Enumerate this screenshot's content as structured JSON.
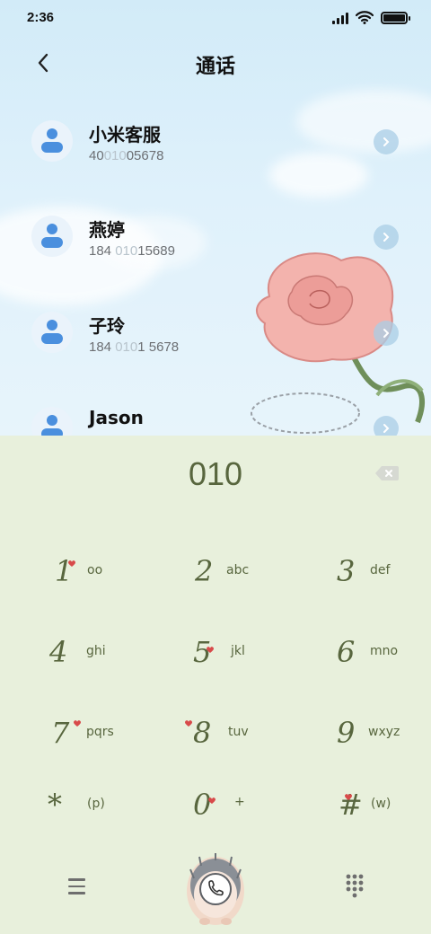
{
  "status_bar": {
    "time": "2:36",
    "icons": [
      "signal-icon",
      "wifi-icon",
      "battery-icon"
    ]
  },
  "header": {
    "title": "通话",
    "back_icon": "chevron-left-icon"
  },
  "contacts": [
    {
      "name": "小米客服",
      "number_prefix": "40",
      "number_match": "010",
      "number_suffix": "05678"
    },
    {
      "name": "燕婷",
      "number_prefix": "184 ",
      "number_match": "010",
      "number_suffix": "15689"
    },
    {
      "name": "子玲",
      "number_prefix": "184 ",
      "number_match": "010",
      "number_suffix": "1 5678"
    },
    {
      "name": "Jason",
      "number_prefix": "",
      "number_match": "",
      "number_suffix": ""
    }
  ],
  "dialpad": {
    "number": "010",
    "delete_icon": "backspace-icon",
    "keys": [
      {
        "digit": "1",
        "letters": "oo"
      },
      {
        "digit": "2",
        "letters": "abc"
      },
      {
        "digit": "3",
        "letters": "def"
      },
      {
        "digit": "4",
        "letters": "ghi"
      },
      {
        "digit": "5",
        "letters": "jkl"
      },
      {
        "digit": "6",
        "letters": "mno"
      },
      {
        "digit": "7",
        "letters": "pqrs"
      },
      {
        "digit": "8",
        "letters": "tuv"
      },
      {
        "digit": "9",
        "letters": "wxyz"
      },
      {
        "digit": "*",
        "letters": "(p)"
      },
      {
        "digit": "0",
        "letters": "+"
      },
      {
        "digit": "#",
        "letters": "(w)"
      }
    ]
  },
  "bottom_bar": {
    "menu_icon": "menu-icon",
    "call_icon": "phone-icon",
    "keypad_icon": "keypad-icon"
  },
  "colors": {
    "accent_green": "#58663e",
    "avatar_blue": "#4a8fde",
    "dialpad_bg": "#e8f0dc",
    "heart_red": "#d84a4a"
  }
}
